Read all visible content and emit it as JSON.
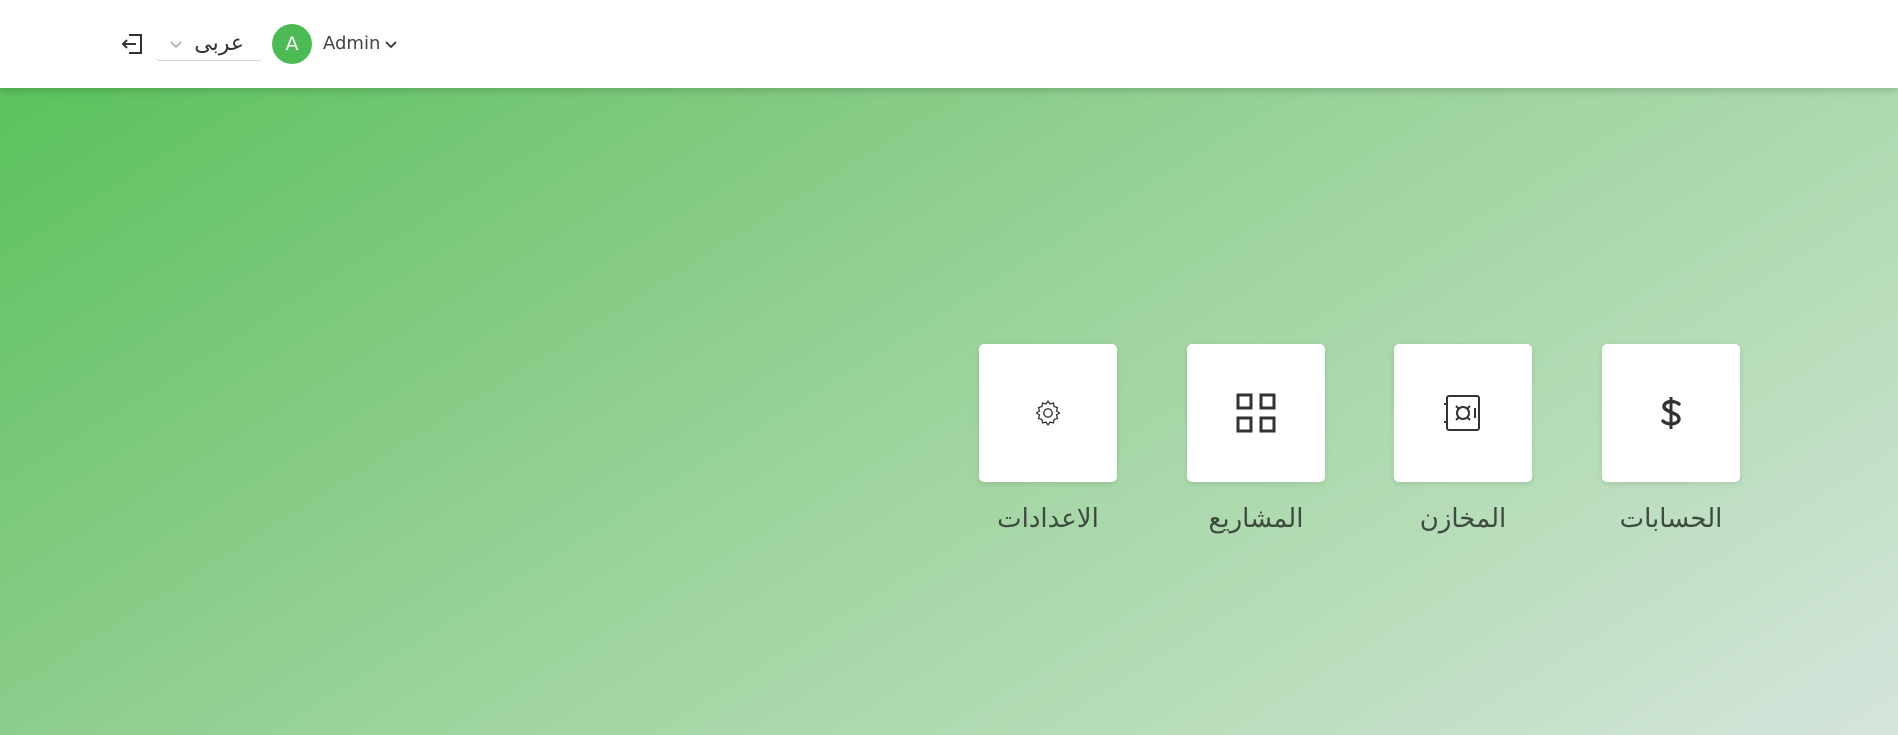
{
  "header": {
    "language_value": "عربى",
    "user_initial": "A",
    "user_name": "Admin"
  },
  "icons": {
    "logout": "logout-icon",
    "language_dropdown": "chevron-down-icon",
    "user_menu": "chevron-down-icon"
  },
  "colors": {
    "accent": "#4dbb55",
    "gradient_start": "#5ac25c",
    "gradient_end": "#d5e5dd",
    "tile_bg": "#ffffff",
    "label_text": "#3d4a3f"
  },
  "modules": [
    {
      "label": "الاعدادات",
      "icon": "gear-icon"
    },
    {
      "label": "المشاريع",
      "icon": "grid-icon"
    },
    {
      "label": "المخازن",
      "icon": "safe-icon"
    },
    {
      "label": "الحسابات",
      "icon": "dollar-icon"
    }
  ]
}
